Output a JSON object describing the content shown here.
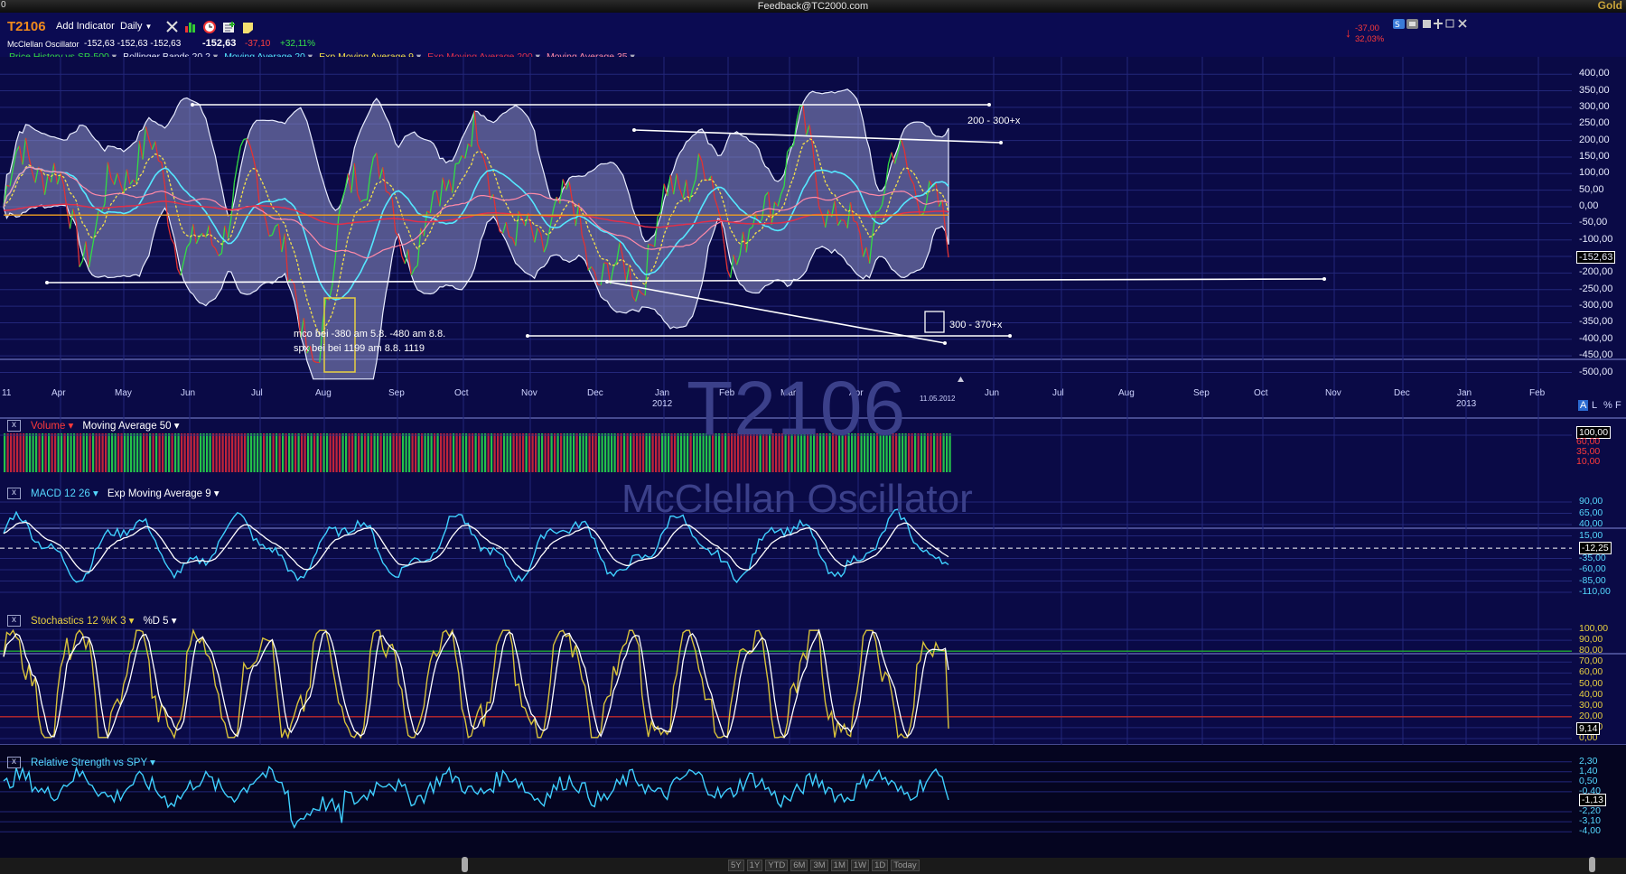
{
  "window": {
    "feedback": "Feedback@TC2000.com",
    "brand": "Gold",
    "edge_glyph": "0"
  },
  "toolbar": {
    "symbol": "T2106",
    "add_indicator": "Add Indicator",
    "timeframe": "Daily",
    "symbol_name": "McClellan Oscillator",
    "quote": "-152,63  -152,63  -152,63",
    "last": "-152,63",
    "change": "-37,10",
    "change_pct": "+32,11%",
    "right_change": "-37,00",
    "right_change_pct": "32,03%"
  },
  "main_legend": [
    {
      "label": "Price History",
      "suffix": " vs SP-500",
      "color": "#33dd44"
    },
    {
      "label": "Bollinger Bands 20 2",
      "suffix": "",
      "color": "#e8ecff"
    },
    {
      "label": "Moving Average 20",
      "suffix": "",
      "color": "#55e8ff"
    },
    {
      "label": "Exp Moving Average 9",
      "suffix": "",
      "color": "#f4e04a"
    },
    {
      "label": "Exp Moving Average 200",
      "suffix": "",
      "color": "#e0304a"
    },
    {
      "label": "Moving Average 35",
      "suffix": "",
      "color": "#ff8aa8"
    }
  ],
  "main_axis": [
    "400,00",
    "350,00",
    "300,00",
    "250,00",
    "200,00",
    "150,00",
    "100,00",
    "50,00",
    "0,00",
    "-50,00",
    "-100,00",
    "-152,63",
    "-200,00",
    "-250,00",
    "-300,00",
    "-350,00",
    "-400,00",
    "-450,00",
    "-500,00"
  ],
  "main_last_value": "-152,63",
  "months": [
    "11",
    "Apr",
    "May",
    "Jun",
    "Jul",
    "Aug",
    "Sep",
    "Oct",
    "Nov",
    "Dec",
    "Jan",
    "Feb",
    "Mar",
    "Apr",
    "Jun",
    "Jul",
    "Aug",
    "Sep",
    "Oct",
    "Nov",
    "Dec",
    "Jan",
    "Feb"
  ],
  "years": [
    "2012",
    "2013"
  ],
  "date_marker": "11.05.2012",
  "annotations": {
    "line1": "mco bei -380 am 5.8. -480 am 8.8.",
    "line2": "spx bei bei 1199 am 8.8. 1119",
    "top_right": "200 - 300+x",
    "bottom_right": "300 - 370+x"
  },
  "scale_buttons": [
    "A",
    "L",
    "%",
    "F"
  ],
  "watermark": {
    "symbol": "T2106",
    "name": "McClellan Oscillator"
  },
  "volume_panel": {
    "title": "Volume",
    "ma": "Moving Average 50",
    "axis": [
      "100,00",
      "60,00",
      "35,00",
      "10,00"
    ],
    "last": "100,00"
  },
  "macd_panel": {
    "title": "MACD 12 26",
    "ema": "Exp Moving Average 9",
    "axis": [
      "90,00",
      "65,00",
      "40,00",
      "15,00",
      "-12,25",
      "-35,00",
      "-60,00",
      "-85,00",
      "-110,00"
    ],
    "last": "-12,25"
  },
  "stoch_panel": {
    "title": "Stochastics 12 %K 3",
    "d": "%D 5",
    "axis": [
      "100,00",
      "90,00",
      "80,00",
      "70,00",
      "60,00",
      "50,00",
      "40,00",
      "30,00",
      "20,00",
      "10,00",
      "0,00"
    ],
    "last": "9,14"
  },
  "rs_panel": {
    "title": "Relative Strength vs SPY",
    "axis": [
      "2,30",
      "1,40",
      "0,50",
      "-0,40",
      "-1,13",
      "-2,20",
      "-3,10",
      "-4,00"
    ],
    "last": "-1,13"
  },
  "timeframes": [
    "5Y",
    "1Y",
    "YTD",
    "6M",
    "3M",
    "1M",
    "1W",
    "1D",
    "Today"
  ],
  "colors": {
    "background": "#0a0a46",
    "price": "#33dd44",
    "price_down": "#e23232",
    "bands": "#e8ecff",
    "ma20": "#55e8ff",
    "ema9": "#f4e04a",
    "ema200": "#e0304a",
    "ma35": "#ff8aa8",
    "macd": "#3fd0ff",
    "stoch_k": "#d8c23a"
  },
  "icons": [
    "tools-icon",
    "bars-icon",
    "alarm-icon",
    "add-note-icon",
    "note-icon",
    "settings-icon",
    "window-icon",
    "pin-icon",
    "close-icon"
  ]
}
